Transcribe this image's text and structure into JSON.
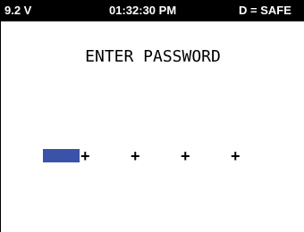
{
  "status_bar": {
    "voltage": "9.2 V",
    "time": "01:32:30 PM",
    "mode": "D = SAFE"
  },
  "prompt": {
    "title": "ENTER PASSWORD"
  },
  "password": {
    "digit_placeholder": "+",
    "cursor_color": "#3a52a8",
    "digits_total": 4,
    "active_index": 0
  }
}
